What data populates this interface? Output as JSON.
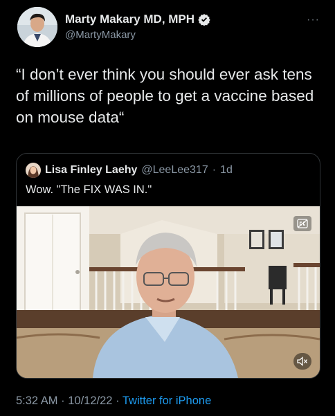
{
  "author": {
    "name": "Marty Makary MD, MPH",
    "handle": "@MartyMakary",
    "verified_icon": "verified-badge-icon"
  },
  "more_icon": "more-options-icon",
  "tweet": {
    "text": "“I don’t ever think you should ever ask tens of millions of people to get a vaccine based on mouse data“"
  },
  "quoted": {
    "name": "Lisa Finley Laehy",
    "handle": "@LeeLee317",
    "separator": "·",
    "age": "1d",
    "text": "Wow. \"The FIX WAS IN.\"",
    "media_icons": [
      "closed-captions-icon",
      "mute-icon"
    ]
  },
  "footer": {
    "time": "5:32 AM",
    "date": "10/12/22",
    "separator": "·",
    "source": "Twitter for iPhone"
  },
  "colors": {
    "background": "#000000",
    "text": "#e7e9ea",
    "secondary": "#8b98a5",
    "link": "#1d9bf0",
    "border": "#2f3336"
  }
}
